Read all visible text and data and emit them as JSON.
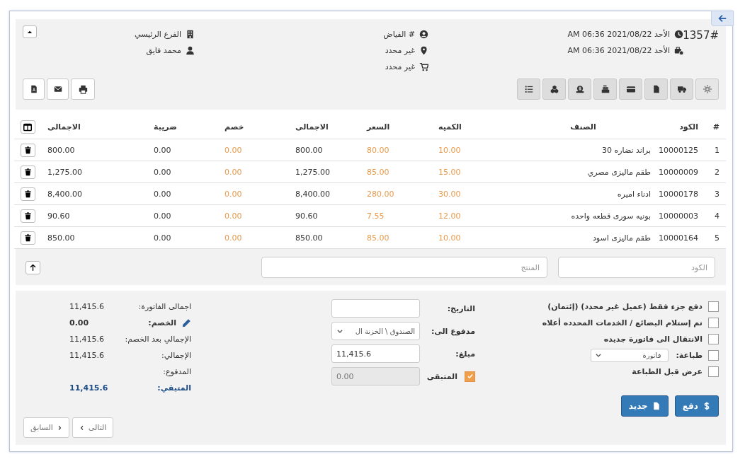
{
  "header": {
    "invoice_number": "1357#",
    "created_at": "الأحد 2021/08/22 06:36 AM",
    "due_at": "الأحد 2021/08/22 06:36 AM",
    "customer": "# الفياض",
    "location": "غير محدد",
    "delivery": "غير محدد",
    "branch": "الفرع الرئيسي",
    "user": "محمد فايق"
  },
  "table": {
    "columns": [
      {
        "label": "#",
        "editable": false
      },
      {
        "label": "الكود",
        "editable": false
      },
      {
        "label": "الصنف",
        "editable": false
      },
      {
        "label": "الكميه",
        "editable": true
      },
      {
        "label": "السعر",
        "editable": true
      },
      {
        "label": "الاجمالى",
        "editable": false
      },
      {
        "label": "خصم",
        "editable": true
      },
      {
        "label": "ضريبة",
        "editable": false
      },
      {
        "label": "الاجمالى",
        "editable": false
      }
    ],
    "rows": [
      [
        "1",
        "10000125",
        "براند نضاره 30",
        "10.00",
        "80.00",
        "800.00",
        "0.00",
        "0.00",
        "800.00"
      ],
      [
        "2",
        "10000009",
        "طقم ماليزى مصري",
        "15.00",
        "85.00",
        "1,275.00",
        "0.00",
        "0.00",
        "1,275.00"
      ],
      [
        "3",
        "10000178",
        "ادناء اميره",
        "30.00",
        "280.00",
        "8,400.00",
        "0.00",
        "0.00",
        "8,400.00"
      ],
      [
        "4",
        "10000003",
        "بونيه سورى قطعه واحده",
        "12.00",
        "7.55",
        "90.60",
        "0.00",
        "0.00",
        "90.60"
      ],
      [
        "5",
        "10000164",
        "طقم ماليزى اسود",
        "10.00",
        "85.00",
        "850.00",
        "0.00",
        "0.00",
        "850.00"
      ]
    ]
  },
  "entry": {
    "code_placeholder": "الكود",
    "product_placeholder": "المنتج"
  },
  "options": [
    {
      "kind": "checkbox",
      "label": "دفع جزء فقط (عميل غير محدد) (إئتمان)",
      "checked": false
    },
    {
      "kind": "checkbox",
      "label": "تم إستلام البضائع / الخدمات المحدده أعلاه",
      "checked": false
    },
    {
      "kind": "checkbox",
      "label": "الانتقال الى فاتورة جديده",
      "checked": false
    },
    {
      "kind": "select",
      "label": "طباعة:",
      "checked": false,
      "value": "فاتورة"
    },
    {
      "kind": "checkbox",
      "label": "عرض قبل الطباعة",
      "checked": false
    }
  ],
  "payment": {
    "date_label": "التاريخ:",
    "paid_to_label": "مدفوع الى:",
    "paid_to_value": "الصندوق \\ الخزنة ال",
    "amount_label": "مبلغ:",
    "amount_value": "11,415.6",
    "remaining_label": "المتبقى",
    "remaining_checked": true,
    "remaining_value": "0.00"
  },
  "totals": [
    {
      "kind": "plain",
      "label": "اجمالى الفاتورة:",
      "value": "11,415.6"
    },
    {
      "kind": "editable",
      "label": "الخصم:",
      "value": "0.00"
    },
    {
      "kind": "plain",
      "label": "الإجمالي بعد الخصم:",
      "value": "11,415.6"
    },
    {
      "kind": "plain",
      "label": "الإجمالي:",
      "value": "11,415.6"
    },
    {
      "kind": "plain",
      "label": "المدفوع:"
    },
    {
      "kind": "highlight",
      "label": "المتبقي:",
      "value": "11,415.6"
    }
  ],
  "actions": [
    {
      "kind": "pay",
      "label": "دفع"
    },
    {
      "kind": "new",
      "label": "جديد"
    }
  ],
  "pager": [
    {
      "label": "التالى"
    },
    {
      "label": "السابق"
    }
  ]
}
